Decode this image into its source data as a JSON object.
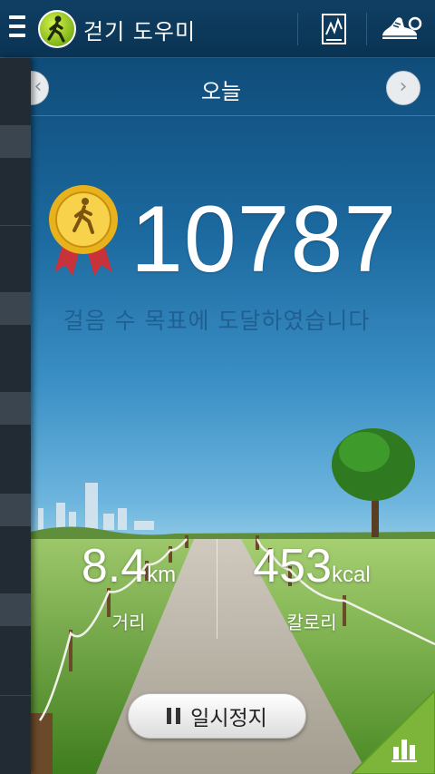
{
  "app": {
    "title": "걷기 도우미"
  },
  "icons": {
    "menu": "hamburger-menu-icon",
    "logo": "walking-person-logo",
    "log": "chart-report-icon",
    "shoe": "running-shoe-icon",
    "prev": "chevron-left-icon",
    "next": "chevron-right-icon",
    "medal": "gold-medal-icon",
    "pause": "pause-icon",
    "stats": "bar-chart-icon"
  },
  "date_nav": {
    "prev": "‹",
    "label": "오늘",
    "next": "›"
  },
  "steps": {
    "count": "10787",
    "message": "걸음 수 목표에 도달하였습니다"
  },
  "stats": {
    "distance": {
      "value": "8.4",
      "unit": "km",
      "label": "거리"
    },
    "calories": {
      "value": "453",
      "unit": "kcal",
      "label": "칼로리"
    }
  },
  "pause_button": {
    "label": "일시정지"
  },
  "colors": {
    "action_bar": "#0f3f63",
    "goal_text": "#1f5f92",
    "logo_green": "#8cc63f",
    "corner_green": "#7cb53a"
  }
}
